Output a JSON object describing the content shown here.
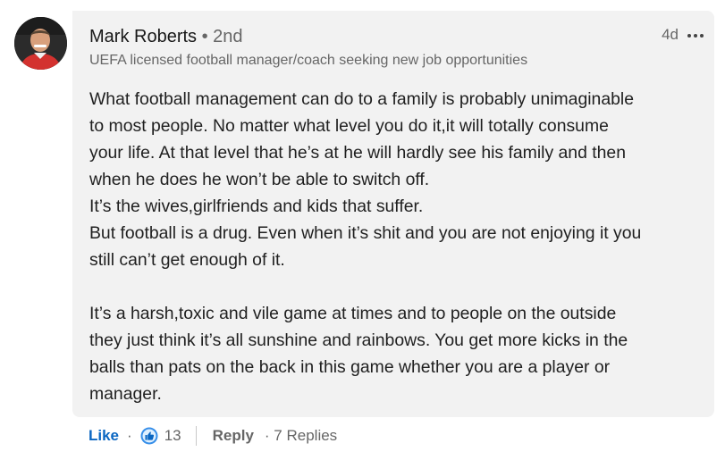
{
  "comment": {
    "author": {
      "name": "Mark Roberts",
      "degree": " • 2nd",
      "headline": "UEFA licensed football manager/coach seeking new job opportunities",
      "avatar_icon": "profile-photo"
    },
    "timestamp": "4d",
    "more_icon": "ellipsis-icon",
    "text": "What football management can do to a family is probably unimaginable\nto most people. No matter what level you do it,it will totally consume\nyour life. At that level that he’s at he will hardly see his family and then\nwhen he does he won’t be able to switch off.\nIt’s the wives,girlfriends and kids that suffer.\nBut football is a drug. Even when it’s shit and you are not enjoying it you\nstill can’t get enough of it.\n\nIt’s a harsh,toxic and vile game at times and to people on the outside\nthey just think it’s all sunshine and rainbows. You get more kicks in the\nballs than pats on the back in this game whether you are a player or\nmanager."
  },
  "actions": {
    "like_label": "Like",
    "dot": "·",
    "reaction_icon": "like-reaction-icon",
    "reaction_count": "13",
    "reply_label": "Reply",
    "replies_label": "· 7 Replies"
  },
  "colors": {
    "like_blue": "#0a66c2",
    "bubble_bg": "#f2f2f2",
    "muted": "#666666"
  }
}
